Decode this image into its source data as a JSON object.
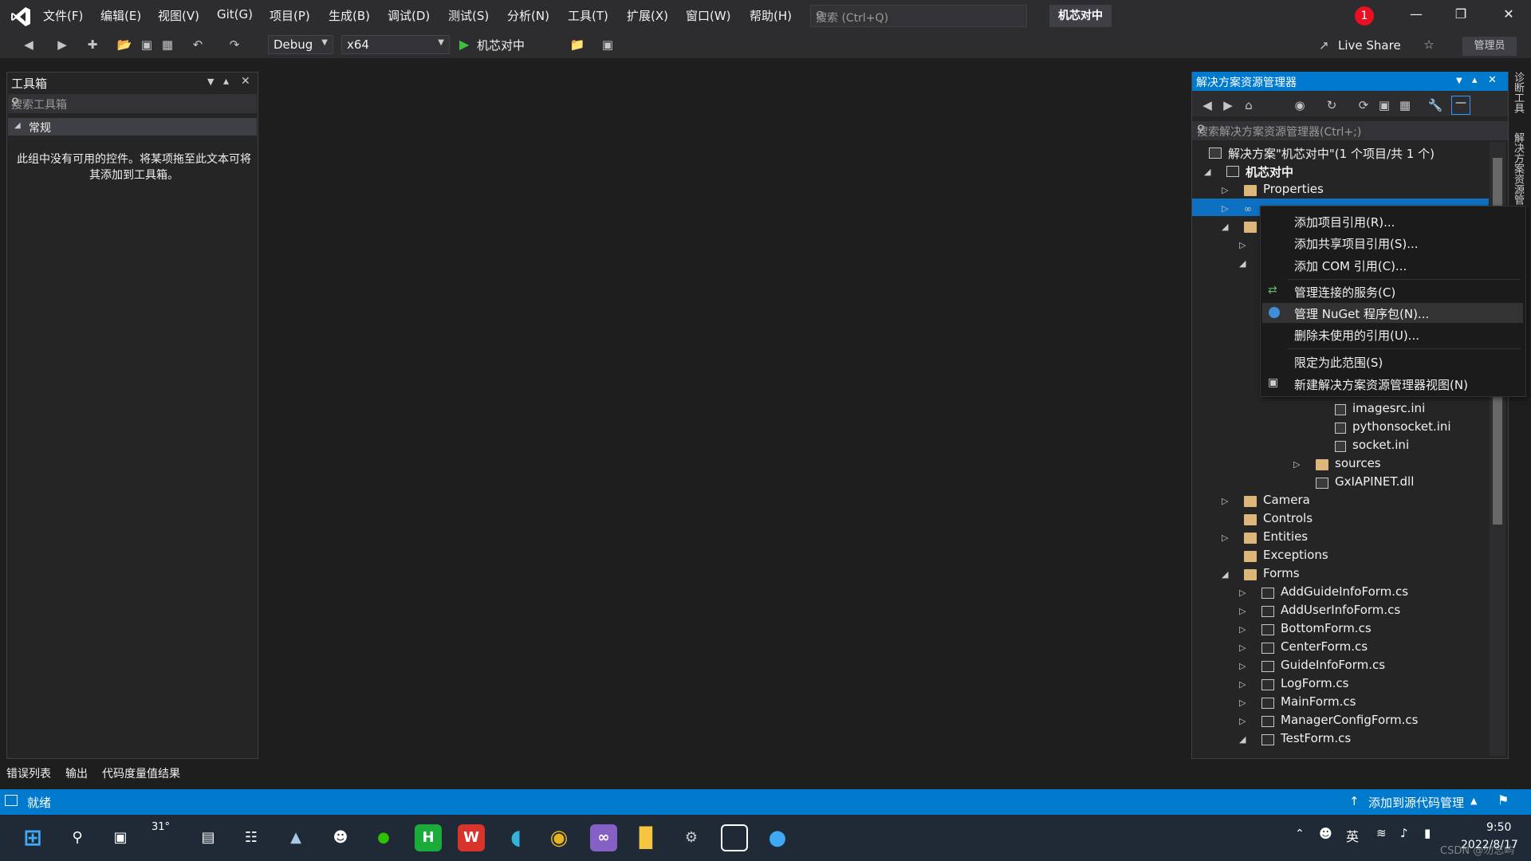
{
  "titlebar": {
    "menus": [
      "文件(F)",
      "编辑(E)",
      "视图(V)",
      "Git(G)",
      "项目(P)",
      "生成(B)",
      "调试(D)",
      "测试(S)",
      "分析(N)",
      "工具(T)",
      "扩展(X)",
      "窗口(W)",
      "帮助(H)"
    ],
    "search_placeholder": "搜索 (Ctrl+Q)",
    "project_name": "机芯对中",
    "notification_count": "1"
  },
  "toolbar": {
    "config": "Debug",
    "platform": "x64",
    "run_target": "机芯对中",
    "live_share": "Live Share",
    "admin": "管理员"
  },
  "toolbox": {
    "title": "工具箱",
    "search_placeholder": "搜索工具箱",
    "group": "常规",
    "empty_message": "此组中没有可用的控件。将某项拖至此文本可将其添加到工具箱。"
  },
  "bottom_tabs": [
    "错误列表",
    "输出",
    "代码度量值结果"
  ],
  "solution_explorer": {
    "title": "解决方案资源管理器",
    "search_placeholder": "搜索解决方案资源管理器(Ctrl+;)",
    "solution_label": "解决方案\"机芯对中\"(1 个项目/共 1 个)",
    "project_label": "机芯对中",
    "items": {
      "properties": "Properties",
      "imagesrc": "imagesrc.ini",
      "pythonsocket": "pythonsocket.ini",
      "socket": "socket.ini",
      "sources": "sources",
      "gxiapi": "GxIAPINET.dll",
      "camera": "Camera",
      "controls": "Controls",
      "entities": "Entities",
      "exceptions": "Exceptions",
      "forms": "Forms",
      "addguide": "AddGuideInfoForm.cs",
      "adduser": "AddUserInfoForm.cs",
      "bottom": "BottomForm.cs",
      "center": "CenterForm.cs",
      "guideinfo": "GuideInfoForm.cs",
      "log": "LogForm.cs",
      "main": "MainForm.cs",
      "managerconfig": "ManagerConfigForm.cs",
      "test": "TestForm.cs"
    }
  },
  "context_menu": {
    "add_project_ref": "添加项目引用(R)...",
    "add_shared_ref": "添加共享项目引用(S)...",
    "add_com_ref": "添加 COM 引用(C)...",
    "manage_services": "管理连接的服务(C)",
    "manage_nuget": "管理 NuGet 程序包(N)...",
    "remove_unused": "删除未使用的引用(U)...",
    "scope_to_this": "限定为此范围(S)",
    "new_se_view": "新建解决方案资源管理器视图(N)"
  },
  "side_tabs": {
    "diagnostics": "诊断工具",
    "solution_explorer": "解决方案资源管理器"
  },
  "statusbar": {
    "ready": "就绪",
    "add_source_control": "添加到源代码管理"
  },
  "taskbar": {
    "weather": "31°",
    "ime": "英",
    "time": "9:50",
    "date": "2022/8/17",
    "watermark": "CSDN @勿忘屿"
  },
  "colors": {
    "accent": "#007acc",
    "background": "#1e1e1e",
    "panel": "#252526",
    "vs_purple": "#8661c5"
  }
}
